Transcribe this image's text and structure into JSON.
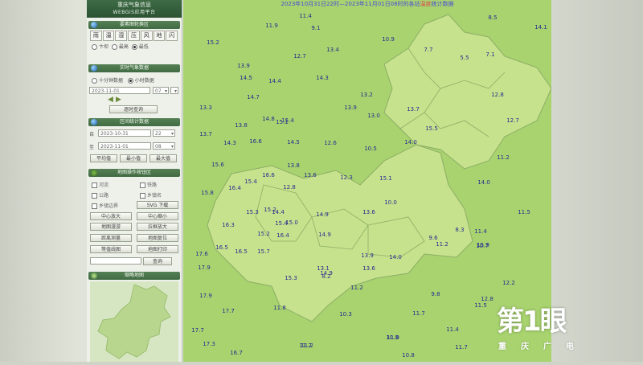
{
  "panel": {
    "logo_line1": "重庆气象信息",
    "logo_line2": "WEBGIS应用平台",
    "sections": {
      "element_display": "要素图轮换区",
      "realtime": "实时气象数据",
      "interval": "区间统计数据",
      "map_ops": "地图操作按钮区",
      "thumbnail": "缩略地图"
    },
    "elements": [
      "雨",
      "温",
      "湿",
      "压",
      "风",
      "地",
      "闪"
    ],
    "element_radios": [
      "卞坝",
      "最高",
      "最低"
    ],
    "realtime_radios": [
      "十分钟数据",
      "小时数据"
    ],
    "realtime_date": "2023-11-01",
    "realtime_hour": "07",
    "realtime_query": "逐时查询",
    "interval_from_date": "2023-10-31",
    "interval_from_hour": "22",
    "interval_to_date": "2023-11-01",
    "interval_to_hour": "08",
    "interval_from_label": "自",
    "interval_to_label": "至",
    "interval_buttons": [
      "平均值",
      "最小值",
      "最大值"
    ],
    "map_checks": [
      "河流",
      "铁路",
      "公路",
      "乡镇名",
      "乡镇边界"
    ],
    "map_buttons": [
      "中心放大",
      "中心缩小",
      "SVG 下载",
      "地图漫游",
      "拉框放大",
      "距离测量",
      "地图复位",
      "等值线图",
      "地图打印"
    ],
    "search_button": "查询"
  },
  "map": {
    "title_prefix": "2023年10月31日22时—2023年11月01日08时的各站",
    "title_element": "温度",
    "title_suffix": "统计数据",
    "values": [
      "11.4",
      "9.1",
      "8.5",
      "14.1",
      "11.9",
      "10.9",
      "15.2",
      "12.7",
      "13.4",
      "7.7",
      "5.5",
      "7.1",
      "13.9",
      "14.5",
      "14.4",
      "14.3",
      "13.2",
      "14.7",
      "12.8",
      "13.3",
      "13.9",
      "13.0",
      "13.7",
      "12.7",
      "15.1",
      "15.4",
      "14.8",
      "15.5",
      "13.8",
      "13.7",
      "14.3",
      "16.6",
      "14.5",
      "12.6",
      "10.5",
      "14.0",
      "11.2",
      "15.6",
      "13.8",
      "16.6",
      "13.6",
      "12.3",
      "15.1",
      "15.4",
      "15.8",
      "16.4",
      "12.8",
      "14.0",
      "15.3",
      "15.2",
      "14.4",
      "14.9",
      "13.6",
      "10.0",
      "11.5",
      "16.3",
      "15.4",
      "15.0",
      "8.3",
      "15.2",
      "16.4",
      "14.9",
      "11.4",
      "15.9",
      "10.7",
      "17.6",
      "16.5",
      "16.5",
      "15.7",
      "13.9",
      "14.0",
      "9.6",
      "11.2",
      "17.9",
      "13.1",
      "14.9",
      "8.2",
      "15.3",
      "13.6",
      "11.2",
      "12.2",
      "17.9",
      "9.8",
      "17.7",
      "11.8",
      "11.7",
      "10.3",
      "12.8",
      "11.5",
      "17.7",
      "11.4",
      "11.0",
      "11.2",
      "17.3",
      "11.2",
      "10.9",
      "11.7",
      "16.7",
      "10.8"
    ]
  },
  "watermark": {
    "main": "第1眼",
    "sub": "重庆广电"
  }
}
